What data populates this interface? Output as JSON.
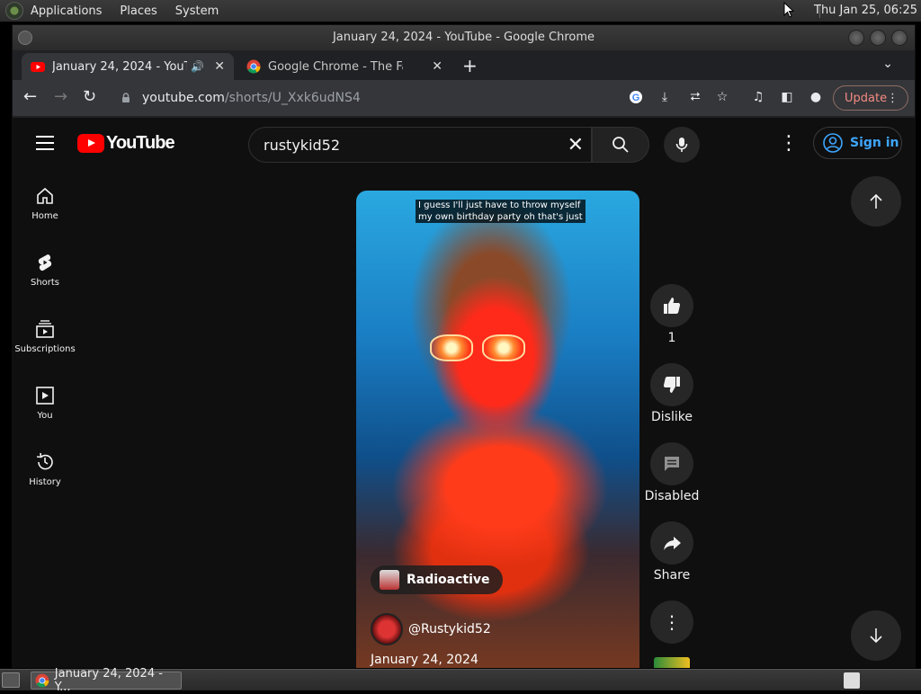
{
  "desktop": {
    "menus": [
      "Applications",
      "Places",
      "System"
    ],
    "clock": "Thu Jan 25, 06:25"
  },
  "window": {
    "title": "January 24, 2024 - YouTube - Google Chrome"
  },
  "tabs": [
    {
      "title": "January 24, 2024 - YouTube",
      "favicon": "youtube-icon",
      "audio": true
    },
    {
      "title": "Google Chrome - The Fast & Secure",
      "favicon": "chrome-icon",
      "audio": false
    }
  ],
  "toolbar": {
    "url_host": "youtube.com",
    "url_path": "/shorts/U_Xxk6udNS4",
    "update_label": "Update"
  },
  "youtube": {
    "logo_text": "YouTube",
    "search_value": "rustykid52",
    "signin_label": "Sign in",
    "guide": [
      {
        "label": "Home",
        "icon": "home-icon"
      },
      {
        "label": "Shorts",
        "icon": "shorts-icon"
      },
      {
        "label": "Subscriptions",
        "icon": "subscriptions-icon"
      },
      {
        "label": "You",
        "icon": "you-icon"
      },
      {
        "label": "History",
        "icon": "history-icon"
      }
    ],
    "short": {
      "caption_line1": "I guess I'll just have to throw myself",
      "caption_line2": "my own birthday party oh that's just",
      "music": "Radioactive",
      "channel": "@Rustykid52",
      "date": "January 24, 2024"
    },
    "actions": {
      "like_count": "1",
      "dislike_label": "Dislike",
      "comments_label": "Disabled",
      "share_label": "Share"
    }
  },
  "taskbar": {
    "task_title": "January 24, 2024 - Y..."
  },
  "colors": {
    "accent": "#3ea6ff",
    "brand_red": "#ff0000",
    "update": "#f28b82"
  }
}
